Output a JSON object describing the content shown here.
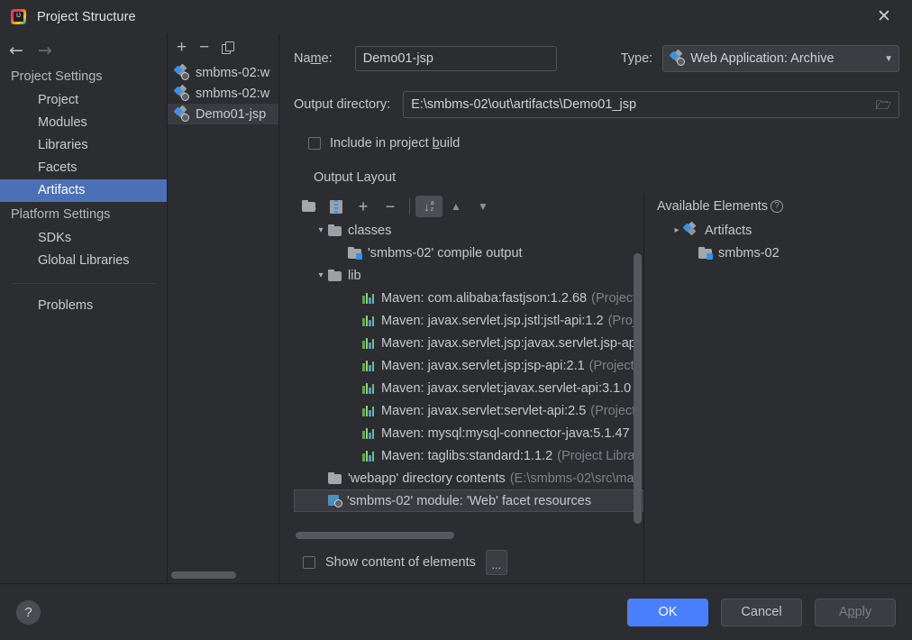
{
  "window": {
    "title": "Project Structure",
    "logo_icon": "intellij-idea-icon",
    "close_icon": "close-icon"
  },
  "sidebar": {
    "back_icon": "back-arrow-icon",
    "forward_icon": "forward-arrow-icon",
    "groups": [
      {
        "label": "Project Settings",
        "items": [
          {
            "label": "Project",
            "selected": false
          },
          {
            "label": "Modules",
            "selected": false
          },
          {
            "label": "Libraries",
            "selected": false
          },
          {
            "label": "Facets",
            "selected": false
          },
          {
            "label": "Artifacts",
            "selected": true
          }
        ]
      },
      {
        "label": "Platform Settings",
        "items": [
          {
            "label": "SDKs",
            "selected": false
          },
          {
            "label": "Global Libraries",
            "selected": false
          }
        ]
      }
    ],
    "problems": {
      "label": "Problems"
    }
  },
  "artifacts_panel": {
    "toolbar": [
      {
        "name": "add-artifact-button",
        "glyph": "+"
      },
      {
        "name": "remove-artifact-button",
        "glyph": "−"
      },
      {
        "name": "copy-artifact-button",
        "glyph": "copy-icon"
      }
    ],
    "items": [
      {
        "label": "smbms-02:w",
        "icon": "web-archive-icon",
        "selected": false
      },
      {
        "label": "smbms-02:w",
        "icon": "web-exploded-icon",
        "selected": false
      },
      {
        "label": "Demo01-jsp",
        "icon": "web-archive-icon",
        "selected": true
      }
    ]
  },
  "main": {
    "name_label": "Name:",
    "name_label_pre": "Na",
    "name_label_mnemonic": "m",
    "name_label_post": "e:",
    "name_value": "Demo01-jsp",
    "type_label": "Type:",
    "type_value": "Web Application: Archive",
    "type_icon": "web-archive-icon",
    "output_label": "Output directory:",
    "output_value": "E:\\smbms-02\\out\\artifacts\\Demo01_jsp",
    "browse_icon": "folder-browse-icon",
    "include_build": {
      "label_pre": "Include in project ",
      "label_mnemonic": "b",
      "label_post": "uild",
      "checked": false
    },
    "output_layout_label": "Output Layout"
  },
  "tree_toolbar": [
    {
      "name": "add-directory-button",
      "icon": "folder-plus-icon",
      "pressed": false
    },
    {
      "name": "add-archive-button",
      "icon": "archive-icon",
      "pressed": false
    },
    {
      "name": "add-element-button",
      "icon": "plus-icon",
      "pressed": false
    },
    {
      "name": "remove-element-button",
      "icon": "minus-icon",
      "pressed": false
    },
    {
      "name": "sort-alphabetically-button",
      "icon": "sort-az-icon",
      "pressed": true
    },
    {
      "name": "move-up-button",
      "icon": "arrow-up-icon",
      "pressed": false
    },
    {
      "name": "move-down-button",
      "icon": "arrow-down-icon",
      "pressed": false
    }
  ],
  "output_tree": [
    {
      "indent": 1,
      "chevron": "down",
      "icon": "folder-icon",
      "text": "classes",
      "suffix": "",
      "selected": false
    },
    {
      "indent": 2,
      "chevron": "",
      "icon": "folder-module-icon",
      "text": "'smbms-02' compile output",
      "suffix": "",
      "selected": false
    },
    {
      "indent": 1,
      "chevron": "down",
      "icon": "folder-icon",
      "text": "lib",
      "suffix": "",
      "selected": false
    },
    {
      "indent": 2,
      "chevron": "",
      "icon": "maven-library-icon",
      "text": "Maven: com.alibaba:fastjson:1.2.68",
      "suffix": "(Project",
      "selected": false
    },
    {
      "indent": 2,
      "chevron": "",
      "icon": "maven-library-icon",
      "text": "Maven: javax.servlet.jsp.jstl:jstl-api:1.2",
      "suffix": "(Proj",
      "selected": false
    },
    {
      "indent": 2,
      "chevron": "",
      "icon": "maven-library-icon",
      "text": "Maven: javax.servlet.jsp:javax.servlet.jsp-api",
      "suffix": "",
      "selected": false
    },
    {
      "indent": 2,
      "chevron": "",
      "icon": "maven-library-icon",
      "text": "Maven: javax.servlet.jsp:jsp-api:2.1",
      "suffix": "(Project",
      "selected": false
    },
    {
      "indent": 2,
      "chevron": "",
      "icon": "maven-library-icon",
      "text": "Maven: javax.servlet:javax.servlet-api:3.1.0",
      "suffix": "(",
      "selected": false
    },
    {
      "indent": 2,
      "chevron": "",
      "icon": "maven-library-icon",
      "text": "Maven: javax.servlet:servlet-api:2.5",
      "suffix": "(Project",
      "selected": false
    },
    {
      "indent": 2,
      "chevron": "",
      "icon": "maven-library-icon",
      "text": "Maven: mysql:mysql-connector-java:5.1.47",
      "suffix": "",
      "selected": false
    },
    {
      "indent": 2,
      "chevron": "",
      "icon": "maven-library-icon",
      "text": "Maven: taglibs:standard:1.1.2",
      "suffix": "(Project Libra",
      "selected": false
    },
    {
      "indent": 1,
      "chevron": "",
      "icon": "folder-icon",
      "text": "'webapp' directory contents",
      "suffix": "(E:\\smbms-02\\src\\ma",
      "selected": false
    },
    {
      "indent": 1,
      "chevron": "",
      "icon": "module-web-icon",
      "text": "'smbms-02' module: 'Web' facet resources",
      "suffix": "",
      "selected": true
    }
  ],
  "tree_bottom": {
    "show_content_label": "Show content of elements",
    "show_content_checked": false,
    "ellipsis_label": "..."
  },
  "available_elements": {
    "title": "Available Elements",
    "help_icon": "help-icon",
    "items": [
      {
        "indent": 1,
        "chevron": "right",
        "icon": "artifacts-icon",
        "label": "Artifacts"
      },
      {
        "indent": 2,
        "chevron": "",
        "icon": "module-icon",
        "label": "smbms-02"
      }
    ]
  },
  "footer": {
    "help_icon": "help-icon",
    "ok_label": "OK",
    "cancel_label": "Cancel",
    "apply_label": "Apply",
    "apply_pre": "A",
    "apply_mnemonic": "p",
    "apply_post": "ply"
  },
  "colors": {
    "accent": "#4a7ffb",
    "selection": "#4c70b5",
    "background": "#2b2d30",
    "text": "#c6c9cd",
    "dim_text": "#7e8288"
  }
}
